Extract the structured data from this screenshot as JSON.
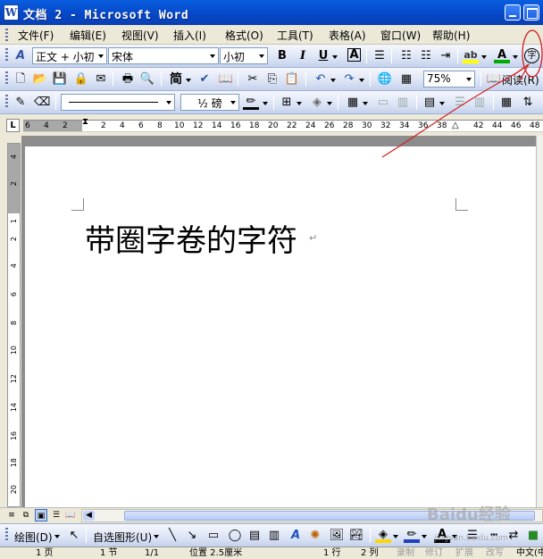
{
  "window": {
    "title": "文档 2 - Microsoft Word",
    "app_icon": "W"
  },
  "menu": [
    "文件(F)",
    "编辑(E)",
    "视图(V)",
    "插入(I)",
    "格式(O)",
    "工具(T)",
    "表格(A)",
    "窗口(W)",
    "帮助(H)"
  ],
  "formatting": {
    "style": "正文 + 小初",
    "font": "宋体",
    "size": "小初",
    "bold": "B",
    "italic": "I",
    "underline": "U",
    "border_char": "A",
    "enclose_char_icon": "字",
    "font_color": "#00aa00"
  },
  "standard": {
    "zoom": "75%",
    "read": "阅读(R)",
    "char_tool": "简"
  },
  "tables_borders": {
    "line_weight": "½ 磅"
  },
  "ruler": {
    "numbers": [
      "6",
      "4",
      "2",
      "2",
      "4",
      "6",
      "8",
      "10",
      "12",
      "14",
      "16",
      "18",
      "20",
      "22",
      "24",
      "26",
      "28",
      "30",
      "32",
      "34",
      "36",
      "38",
      "42",
      "44",
      "46",
      "48"
    ]
  },
  "vruler": {
    "numbers": [
      "4",
      "2",
      "1",
      "2",
      "4",
      "6",
      "8",
      "10",
      "12",
      "14",
      "16",
      "18",
      "20"
    ]
  },
  "document": {
    "text": "带圈字卷的字符",
    "para_mark": "↵"
  },
  "draw": {
    "draw_label": "绘图(D)",
    "autoshapes_label": "自选图形(U)"
  },
  "status": {
    "page": "1 页",
    "section": "1 节",
    "pages": "1/1",
    "position": "位置 2.5厘米",
    "line": "1 行",
    "col": "2 列",
    "rec": "录制",
    "trk": "修订",
    "ext": "扩展",
    "ovr": "改写",
    "lang": "中文(中"
  },
  "watermark": {
    "text": "Baidu经验",
    "sub": "jingyan.baidu.com"
  }
}
